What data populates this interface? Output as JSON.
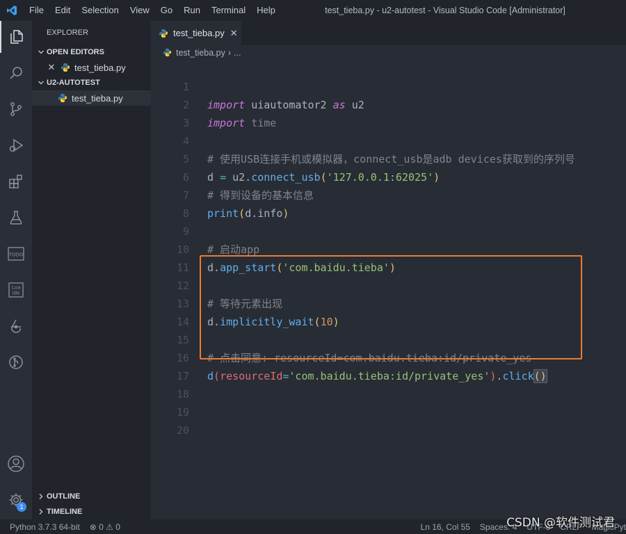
{
  "menu": [
    "File",
    "Edit",
    "Selection",
    "View",
    "Go",
    "Run",
    "Terminal",
    "Help"
  ],
  "window_title": "test_tieba.py - u2-autotest - Visual Studio Code [Administrator]",
  "activity_icons": [
    "explorer-icon",
    "search-icon",
    "source-control-icon",
    "run-debug-icon",
    "extensions-icon",
    "testing-icon",
    "todo-icon",
    "lua-ide-icon",
    "git-graph-icon",
    "gitlens-icon",
    "account-icon",
    "settings-gear-icon"
  ],
  "settings_badge": "1",
  "sidebar": {
    "title": "EXPLORER",
    "open_editors": {
      "header": "OPEN EDITORS",
      "files": [
        "test_tieba.py"
      ]
    },
    "project": {
      "header": "U2-AUTOTEST",
      "files": [
        "test_tieba.py"
      ]
    },
    "outline": "OUTLINE",
    "timeline": "TIMELINE"
  },
  "tab": {
    "label": "test_tieba.py"
  },
  "breadcrumb": {
    "file": "test_tieba.py",
    "rest": "..."
  },
  "code": {
    "line_numbers": [
      "1",
      "2",
      "3",
      "4",
      "5",
      "6",
      "7",
      "8",
      "9",
      "10",
      "11",
      "12",
      "13",
      "14",
      "15",
      "16",
      "17",
      "18",
      "19",
      "20"
    ],
    "l1_kw": "import",
    "l1_mod": " uiautomator2 ",
    "l1_as": "as",
    "l1_alias": " u2",
    "l2_kw": "import",
    "l2_mod": " time",
    "l4": "# 使用USB连接手机或模拟器，connect_usb是adb devices获取到的序列号",
    "l5_a": "d ",
    "l5_eq": "=",
    "l5_b": " u2.",
    "l5_fn": "connect_usb",
    "l5_p1": "(",
    "l5_str": "'127.0.0.1:62025'",
    "l5_p2": ")",
    "l6": "# 得到设备的基本信息",
    "l7_fn": "print",
    "l7_p1": "(",
    "l7_arg": "d.info",
    "l7_p2": ")",
    "l9": "# 启动app",
    "l10_a": "d.",
    "l10_fn": "app_start",
    "l10_p1": "(",
    "l10_str": "'com.baidu.tieba'",
    "l10_p2": ")",
    "l12": "# 等待元素出现",
    "l13_a": "d.",
    "l13_fn": "implicitly_wait",
    "l13_p1": "(",
    "l13_num": "10",
    "l13_p2": ")",
    "l15": "# 点击同意: resourceId=com.baidu.tieba:id/private_yes",
    "l16_a": "d",
    "l16_p1": "(",
    "l16_kw": "resourceId",
    "l16_eq": "=",
    "l16_str": "'com.baidu.tieba:id/private_yes'",
    "l16_p2": ")",
    "l16_dot": ".",
    "l16_fn": "click",
    "l16_paren": "()"
  },
  "status": {
    "python": "Python 3.7.3 64-bit",
    "errors": "0",
    "warnings": "0",
    "position": "Ln 16, Col 55",
    "spaces": "Spaces: 4",
    "encoding": "UTF-8",
    "eol": "CRLF",
    "extra": "MagicPyt"
  },
  "watermark": "CSDN @软件测试君",
  "colors": {
    "highlight_border": "#ee7c2e",
    "accent": "#3f8ef0"
  }
}
